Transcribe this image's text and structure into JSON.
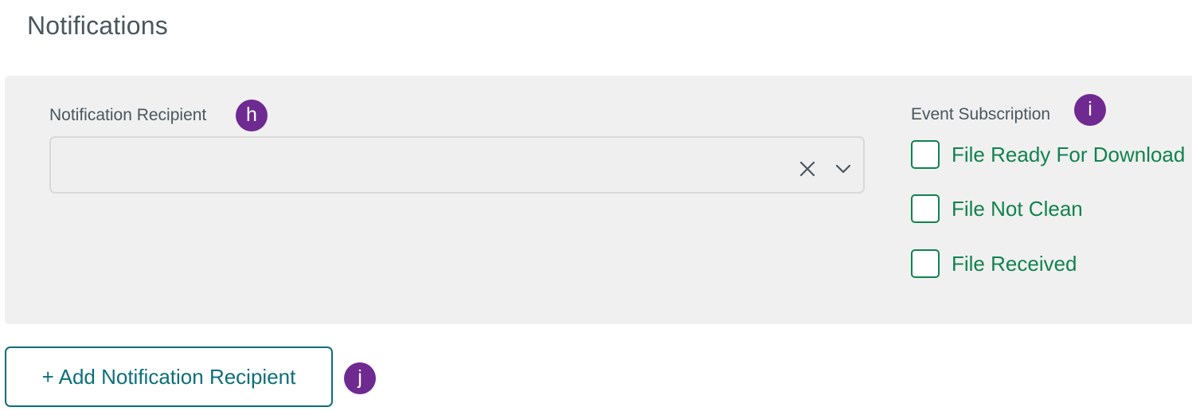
{
  "section": {
    "title": "Notifications"
  },
  "recipient": {
    "label": "Notification Recipient",
    "badge": "h",
    "value": "",
    "clear_icon": "close-icon",
    "dropdown_icon": "chevron-down-icon"
  },
  "events": {
    "label": "Event Subscription",
    "badge": "i",
    "options": [
      {
        "label": "File Ready For Download",
        "checked": false
      },
      {
        "label": "File Not Clean",
        "checked": false
      },
      {
        "label": "File Received",
        "checked": false
      }
    ]
  },
  "add_button": {
    "label": "+ Add Notification Recipient",
    "badge": "j"
  },
  "colors": {
    "badge": "#6f2a91",
    "checkbox_green": "#11824f",
    "button_teal": "#0c6f7a",
    "panel_bg": "#f0f0f0",
    "text_gray": "#4a565d"
  }
}
